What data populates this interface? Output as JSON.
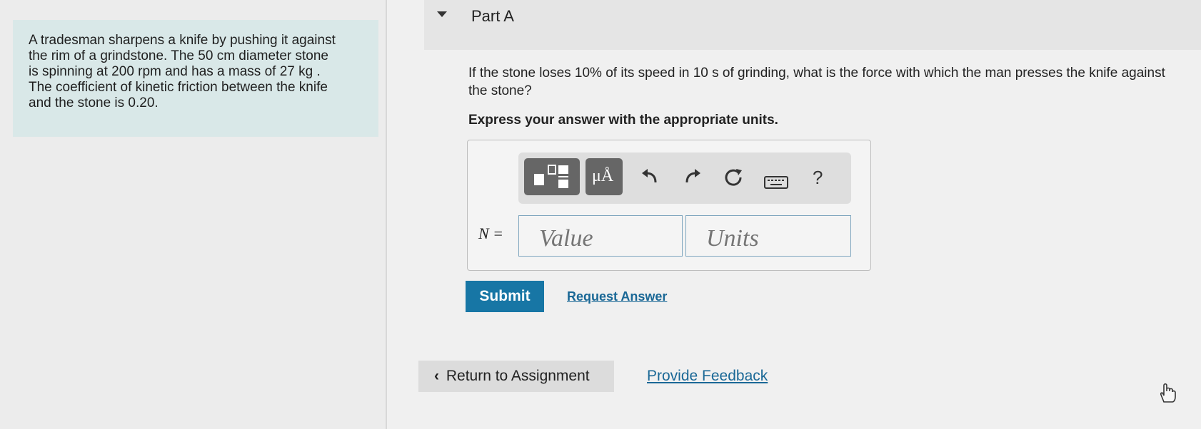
{
  "problem": {
    "lines": [
      "A tradesman sharpens a knife by pushing it against",
      "the rim of a grindstone. The 50  cm diameter stone",
      "is spinning at 200 rpm and has a mass of 27  kg .",
      "The coefficient of kinetic friction between the knife",
      "and the stone is 0.20."
    ]
  },
  "part": {
    "title": "Part A"
  },
  "question": {
    "text": "If the stone loses 10% of its speed in 10 s of grinding, what is the force with which the man presses the knife against the stone?",
    "instruction": "Express your answer with the appropriate units."
  },
  "toolbar": {
    "units_label": "μÅ",
    "help_label": "?"
  },
  "answer": {
    "variable_label": "N =",
    "value_placeholder": "Value",
    "units_placeholder": "Units"
  },
  "actions": {
    "submit_label": "Submit",
    "request_answer_label": "Request Answer"
  },
  "footer": {
    "return_label": "Return to Assignment",
    "feedback_label": "Provide Feedback"
  },
  "colors": {
    "problem_bg": "#d9e8e8",
    "submit_bg": "#1776a5",
    "link": "#1a6896"
  }
}
